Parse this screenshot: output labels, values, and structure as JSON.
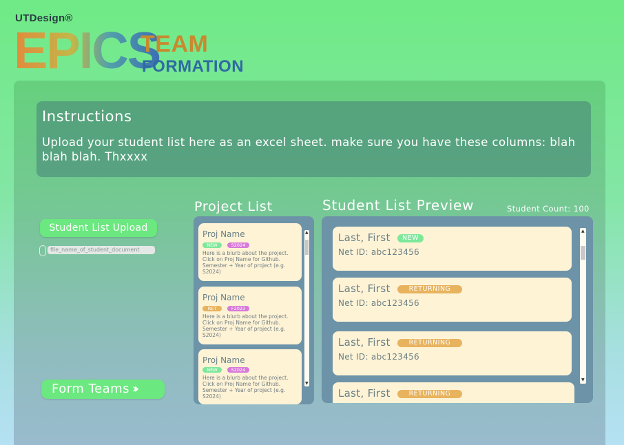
{
  "logo": {
    "brand": "UTDesign®",
    "epics": "EPICS",
    "team": "TEAM",
    "formation": "FORMATION"
  },
  "instructions": {
    "title": "Instructions",
    "body": "Upload your student list here as an excel sheet. make sure you have these columns: blah blah blah. Thxxxx"
  },
  "controls": {
    "upload_label": "Student List Upload",
    "file_name": "file_name_of_student_document",
    "form_teams_label": "Form Teams"
  },
  "project_list": {
    "title": "Project List",
    "projects": [
      {
        "name": "Proj Name",
        "status": "NEW",
        "status_color": "#7ee89a",
        "semester": "S2024",
        "semester_color": "#d77ad8",
        "blurb": "Here is a blurb about the project. Click on Proj Name for Github. Semester + Year of project (e.g. S2024)"
      },
      {
        "name": "Proj Name",
        "status": "RET",
        "status_color": "#e8b35e",
        "semester": "F2023",
        "semester_color": "#d77ad8",
        "blurb": "Here is a blurb about the project. Click on Proj Name for Github. Semester + Year of project (e.g. S2024)"
      },
      {
        "name": "Proj Name",
        "status": "NEW",
        "status_color": "#7ee89a",
        "semester": "S2024",
        "semester_color": "#d77ad8",
        "blurb": "Here is a blurb about the project. Click on Proj Name for Github. Semester + Year of project (e.g. S2024)"
      }
    ]
  },
  "student_list": {
    "title": "Student List Preview",
    "count_label": "Student Count: 100",
    "students": [
      {
        "name": "Last, First",
        "status": "NEW",
        "status_color": "#7ee89a",
        "net_id": "Net ID: abc123456"
      },
      {
        "name": "Last, First",
        "status": "RETURNING",
        "status_color": "#e8b35e",
        "net_id": "Net ID: abc123456"
      },
      {
        "name": "Last, First",
        "status": "RETURNING",
        "status_color": "#e8b35e",
        "net_id": "Net ID: abc123456"
      },
      {
        "name": "Last, First",
        "status": "RETURNING",
        "status_color": "#e8b35e",
        "net_id": ""
      }
    ]
  },
  "colors": {
    "accent_green": "#6be87f",
    "card_bg": "#fff3d6",
    "list_panel": "#6d93a8"
  }
}
